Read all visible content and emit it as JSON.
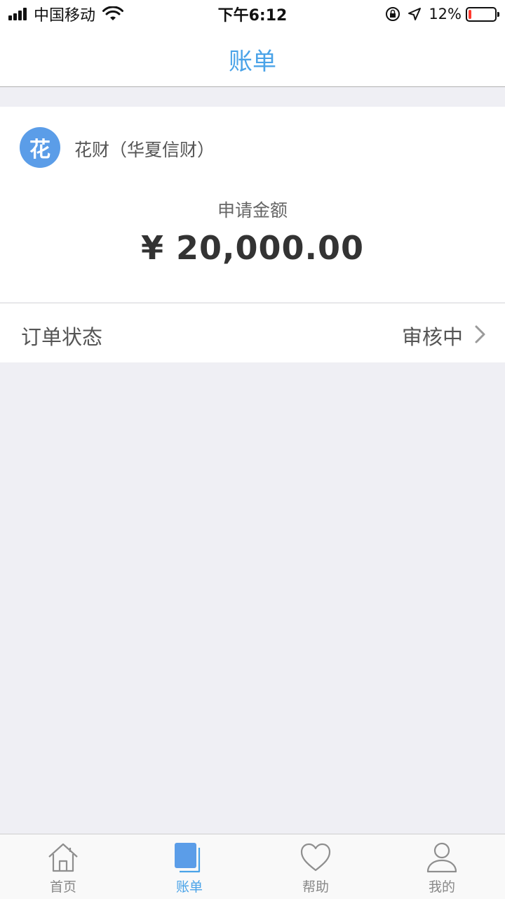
{
  "status_bar": {
    "carrier": "中国移动",
    "time": "下午6:12",
    "battery_percent_text": "12%",
    "battery_level": 0.12
  },
  "nav": {
    "title": "账单"
  },
  "card": {
    "avatar_char": "花",
    "provider_name": "花财（华夏信财）",
    "amount_label": "申请金额",
    "amount": "¥ 20,000.00"
  },
  "order_status": {
    "label": "订单状态",
    "value": "审核中"
  },
  "tabs": [
    {
      "label": "首页",
      "icon": "home-icon",
      "active": false
    },
    {
      "label": "账单",
      "icon": "bill-icon",
      "active": true
    },
    {
      "label": "帮助",
      "icon": "heart-icon",
      "active": false
    },
    {
      "label": "我的",
      "icon": "person-icon",
      "active": false
    }
  ],
  "colors": {
    "accent": "#4aa3e8",
    "avatar": "#5b9de8",
    "battery_low": "#ff3b30",
    "background": "#efeff4"
  }
}
